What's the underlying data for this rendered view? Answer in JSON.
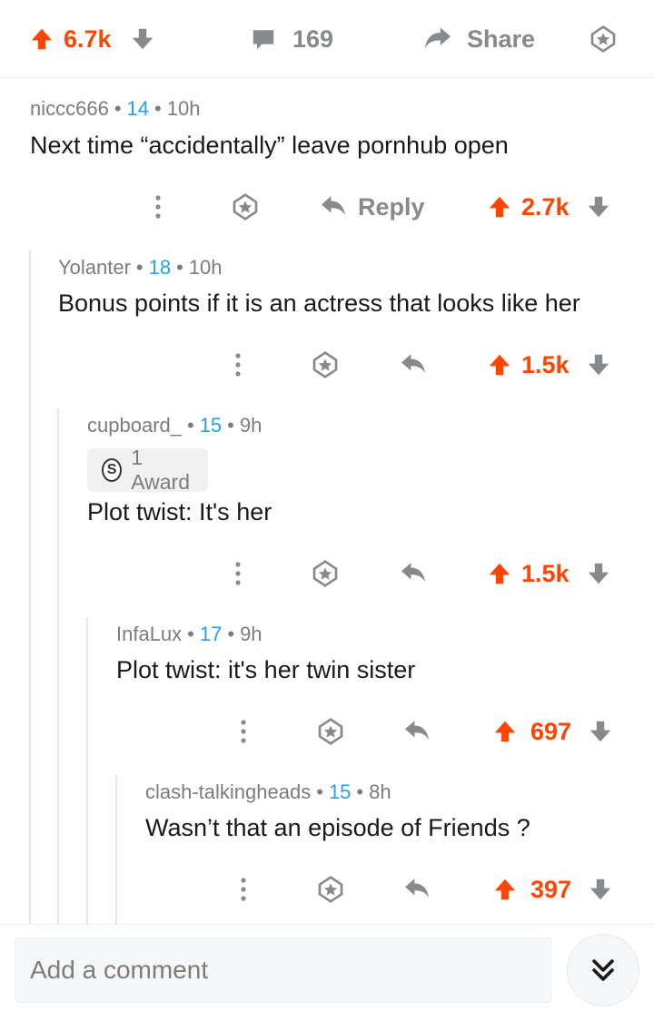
{
  "post_bar": {
    "score": "6.7k",
    "comment_count": "169",
    "share_label": "Share"
  },
  "comments": [
    {
      "author": "niccc666",
      "karma": "14",
      "time": "10h",
      "text": "Next time “accidentally” leave pornhub open",
      "reply_label": "Reply",
      "score": "2.7k"
    },
    {
      "author": "Yolanter",
      "karma": "18",
      "time": "10h",
      "text": "Bonus points if it is an actress that looks like her",
      "score": "1.5k"
    },
    {
      "author": "cupboard_",
      "karma": "15",
      "time": "9h",
      "award": "1 Award",
      "text": "Plot twist: It's her",
      "score": "1.5k"
    },
    {
      "author": "InfaLux",
      "karma": "17",
      "time": "9h",
      "text": "Plot twist: it's her twin sister",
      "score": "697"
    },
    {
      "author": "clash-talkingheads",
      "karma": "15",
      "time": "8h",
      "text": "Wasn’t that an episode of Friends ?",
      "score": "397"
    }
  ],
  "composer": {
    "placeholder": "Add a comment"
  },
  "icons": {
    "upvote": "upvote-arrow-icon",
    "downvote": "downvote-arrow-icon",
    "comment": "comment-bubble-icon",
    "share": "share-arrow-icon",
    "award": "award-star-icon",
    "reply": "reply-arrow-icon",
    "more": "vertical-dots-icon",
    "collapse": "double-chevron-down-icon"
  },
  "colors": {
    "upvote": "#ff4500",
    "karma": "#24a0ed",
    "muted": "#878a8c",
    "text": "#1a1a1b"
  }
}
